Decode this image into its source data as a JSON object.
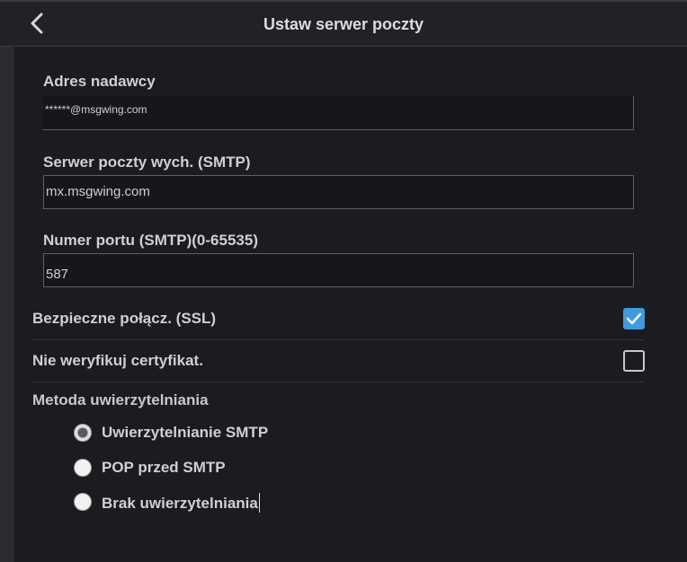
{
  "header": {
    "title": "Ustaw serwer poczty",
    "back_icon": "chevron-left-icon"
  },
  "fields": {
    "sender": {
      "label": "Adres nadawcy",
      "value": "******@msgwing.com"
    },
    "smtp_server": {
      "label": "Serwer poczty wych. (SMTP)",
      "value": "mx.msgwing.com"
    },
    "smtp_port": {
      "label": "Numer portu (SMTP)(0-65535)",
      "value": "587"
    }
  },
  "options": {
    "ssl": {
      "label": "Bezpieczne połącz. (SSL)",
      "checked": true
    },
    "no_verify_cert": {
      "label": "Nie weryfikuj certyfikat.",
      "checked": false
    }
  },
  "auth": {
    "heading": "Metoda uwierzytelniania",
    "methods": [
      {
        "label": "Uwierzytelnianie SMTP",
        "selected": true
      },
      {
        "label": "POP przed SMTP",
        "selected": false
      },
      {
        "label": "Brak uwierzytelniania",
        "selected": false
      }
    ]
  },
  "colors": {
    "accent": "#3f9bdc",
    "background": "#1b1c1f",
    "header": "#212225"
  }
}
